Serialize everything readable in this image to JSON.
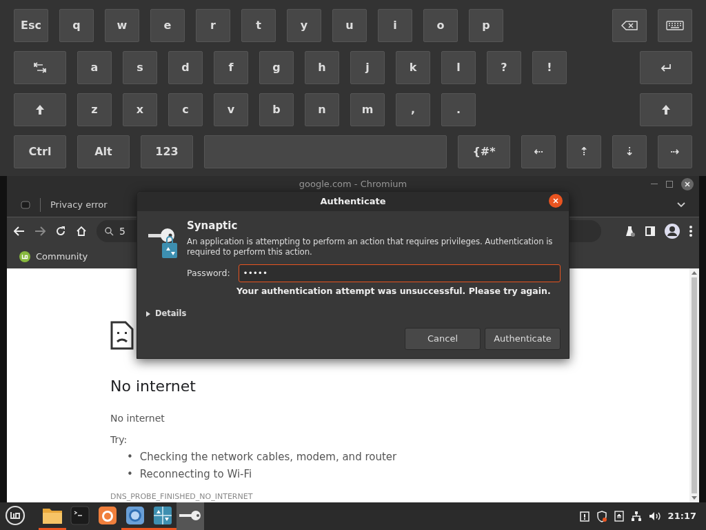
{
  "keyboard": {
    "rows": [
      {
        "left": [
          {
            "kind": "text",
            "label": "Esc"
          },
          {
            "kind": "text",
            "label": "q"
          },
          {
            "kind": "text",
            "label": "w"
          },
          {
            "kind": "text",
            "label": "e"
          },
          {
            "kind": "text",
            "label": "r"
          },
          {
            "kind": "text",
            "label": "t"
          },
          {
            "kind": "text",
            "label": "y"
          },
          {
            "kind": "text",
            "label": "u"
          },
          {
            "kind": "text",
            "label": "i"
          },
          {
            "kind": "text",
            "label": "o"
          },
          {
            "kind": "text",
            "label": "p"
          }
        ],
        "right": [
          {
            "kind": "backspace"
          },
          {
            "kind": "keyboard"
          }
        ]
      },
      {
        "left": [
          {
            "kind": "tab"
          },
          {
            "kind": "text",
            "label": "a"
          },
          {
            "kind": "text",
            "label": "s"
          },
          {
            "kind": "text",
            "label": "d"
          },
          {
            "kind": "text",
            "label": "f"
          },
          {
            "kind": "text",
            "label": "g"
          },
          {
            "kind": "text",
            "label": "h"
          },
          {
            "kind": "text",
            "label": "j"
          },
          {
            "kind": "text",
            "label": "k"
          },
          {
            "kind": "text",
            "label": "l"
          },
          {
            "kind": "text",
            "label": "?"
          },
          {
            "kind": "text",
            "label": "!"
          }
        ],
        "right": [
          {
            "kind": "enter"
          }
        ]
      },
      {
        "left": [
          {
            "kind": "shift"
          },
          {
            "kind": "text",
            "label": "z"
          },
          {
            "kind": "text",
            "label": "x"
          },
          {
            "kind": "text",
            "label": "c"
          },
          {
            "kind": "text",
            "label": "v"
          },
          {
            "kind": "text",
            "label": "b"
          },
          {
            "kind": "text",
            "label": "n"
          },
          {
            "kind": "text",
            "label": "m"
          },
          {
            "kind": "text",
            "label": ","
          },
          {
            "kind": "text",
            "label": "."
          }
        ],
        "right": [
          {
            "kind": "shift"
          }
        ]
      },
      {
        "left": [
          {
            "kind": "wide",
            "label": "Ctrl"
          },
          {
            "kind": "wide",
            "label": "Alt"
          },
          {
            "kind": "wide",
            "label": "123"
          },
          {
            "kind": "space"
          },
          {
            "kind": "wide",
            "label": "{#*"
          },
          {
            "kind": "text",
            "label": "⇠"
          },
          {
            "kind": "text",
            "label": "⇡"
          },
          {
            "kind": "text",
            "label": "⇣"
          },
          {
            "kind": "text",
            "label": "⇢"
          }
        ],
        "right": []
      }
    ]
  },
  "browser": {
    "title": "google.com - Chromium",
    "tab": {
      "title": "Privacy error"
    },
    "omnibox": {
      "value": "5"
    },
    "bookmarks": [
      {
        "label": "Community"
      }
    ],
    "page": {
      "heading": "No internet",
      "message": "No internet",
      "try_label": "Try:",
      "suggestions": [
        {
          "marker": "•",
          "text": "Checking the network cables, modem, and router"
        },
        {
          "marker": "•",
          "text": "Reconnecting to Wi-Fi"
        }
      ],
      "error_code": "DNS_PROBE_FINISHED_NO_INTERNET"
    }
  },
  "dialog": {
    "title": "Authenticate",
    "app_name": "Synaptic",
    "description": "An application is attempting to perform an action that requires privileges. Authentication is required to perform this action.",
    "password_label": "Password:",
    "password_value": "•••••",
    "error": "Your authentication attempt was unsuccessful. Please try again.",
    "details": {
      "label": "Details",
      "expanded": false
    },
    "buttons": [
      {
        "label": "Cancel"
      },
      {
        "label": "Authenticate"
      }
    ]
  },
  "taskbar": {
    "apps": [
      {
        "kind": "files",
        "running": true,
        "active": false
      },
      {
        "kind": "terminal",
        "running": false,
        "active": false
      },
      {
        "kind": "firefox",
        "running": false,
        "active": false
      },
      {
        "kind": "chromium",
        "running": true,
        "active": false
      },
      {
        "kind": "synaptic",
        "running": true,
        "active": false
      },
      {
        "kind": "key",
        "running": false,
        "active": true
      }
    ],
    "clock": "21:17"
  }
}
